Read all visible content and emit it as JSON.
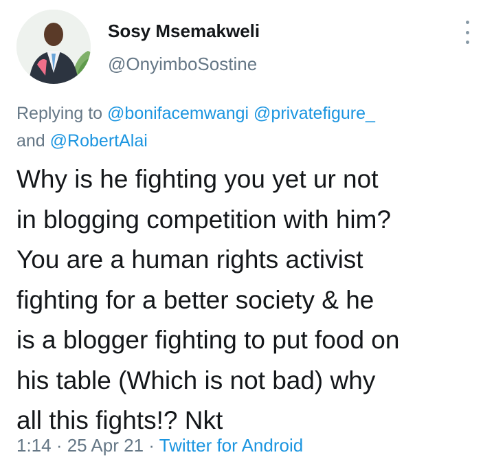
{
  "author": {
    "name": "Sosy Msemakweli",
    "handle": "@OnyimboSostine"
  },
  "replying": {
    "prefix": "Replying to ",
    "mentions": [
      "@bonifacemwangi",
      "@privatefigure_",
      "@RobertAlai"
    ],
    "joiner": "and "
  },
  "tweet": {
    "text": "Why is he fighting you yet ur not\nin blogging competition with him?\nYou are a human rights activist\nfighting for a better society &  he\nis a blogger fighting to put food on\nhis table (Which is not bad) why\nall this fights!? Nkt"
  },
  "meta": {
    "time": "1:14",
    "sep": " · ",
    "date": "25 Apr 21",
    "source": "Twitter for Android"
  },
  "colors": {
    "link": "#1b95e0",
    "secondary": "#657786"
  },
  "icons": {
    "menu": "more-vertical-icon"
  }
}
